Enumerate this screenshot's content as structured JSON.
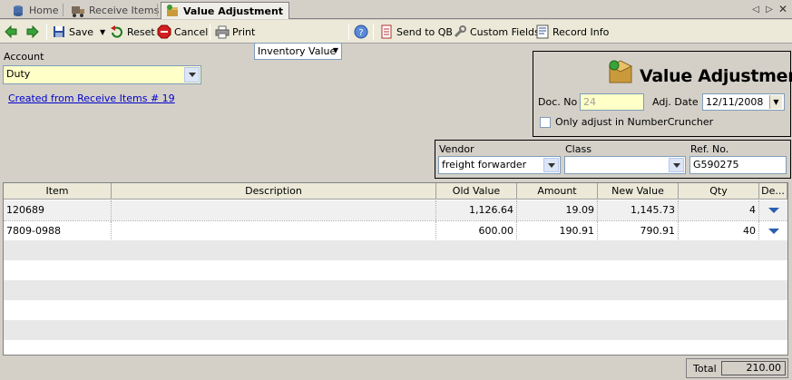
{
  "tabs": [
    {
      "label": "Home",
      "icon": "database-icon"
    },
    {
      "label": "Receive Items",
      "icon": "truck-icon"
    },
    {
      "label": "Value Adjustment",
      "icon": "box-icon",
      "active": true
    }
  ],
  "toolbar": {
    "save": "Save",
    "reset": "Reset",
    "cancel": "Cancel",
    "print": "Print",
    "print_template": "Inventory Value",
    "send_to_qb": "Send to QB",
    "custom_fields": "Custom Fields",
    "record_info": "Record Info"
  },
  "account": {
    "label": "Account",
    "value": "Duty"
  },
  "created_link": "Created from Receive Items # 19",
  "header_panel": {
    "title": "Value Adjustment",
    "doc_no_label": "Doc. No",
    "doc_no_value": "24",
    "adj_date_label": "Adj. Date",
    "adj_date_value": "12/11/2008",
    "only_adjust_label": "Only adjust in NumberCruncher"
  },
  "vendor": {
    "label": "Vendor",
    "value": "freight forwarder"
  },
  "class_field": {
    "label": "Class",
    "value": ""
  },
  "ref_no": {
    "label": "Ref. No.",
    "value": "G590275"
  },
  "grid": {
    "columns": [
      "Item",
      "Description",
      "Old Value",
      "Amount",
      "New Value",
      "Qty",
      "De..."
    ],
    "rows": [
      {
        "item": "120689",
        "description": "",
        "old_value": "1,126.64",
        "amount": "19.09",
        "new_value": "1,145.73",
        "qty": "4"
      },
      {
        "item": "7809-0988",
        "description": "",
        "old_value": "600.00",
        "amount": "190.91",
        "new_value": "790.91",
        "qty": "40"
      }
    ]
  },
  "total": {
    "label": "Total",
    "value": "210.00"
  }
}
